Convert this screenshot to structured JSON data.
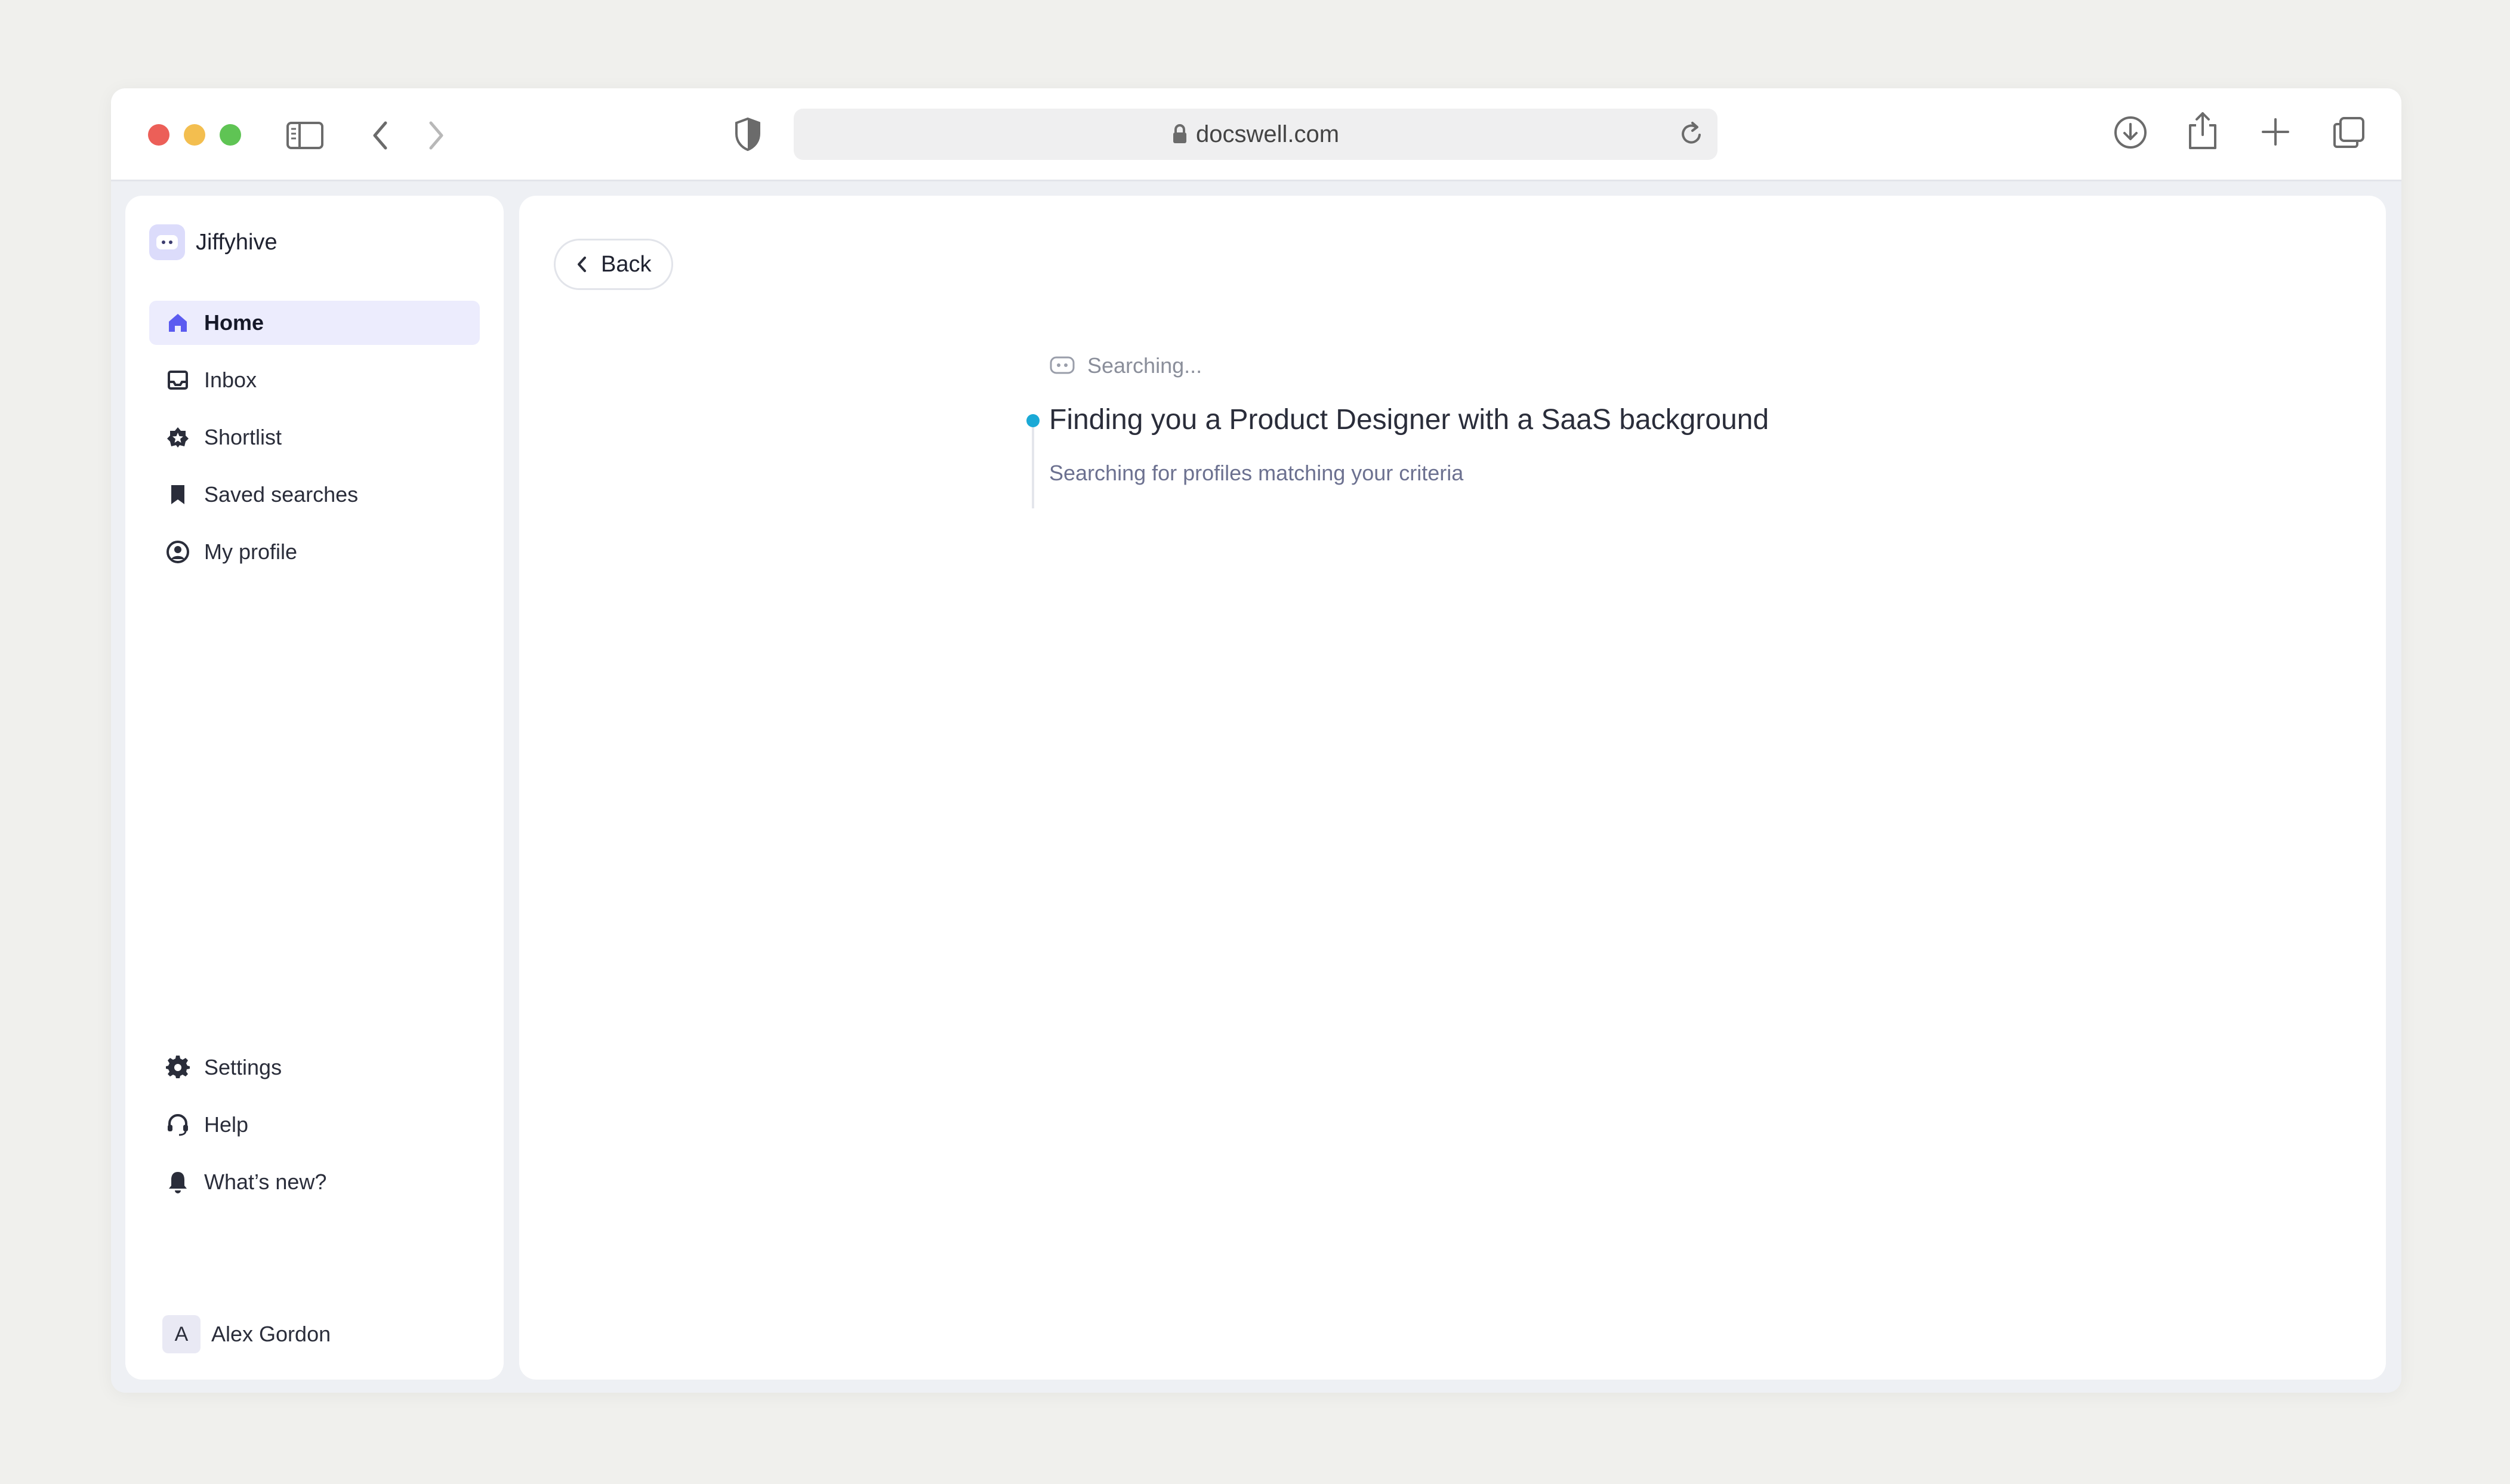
{
  "browser": {
    "url": "docswell.com"
  },
  "app": {
    "brand_name": "Jiffyhive"
  },
  "sidebar": {
    "nav_items": [
      {
        "label": "Home",
        "icon": "home-icon",
        "active": true
      },
      {
        "label": "Inbox",
        "icon": "inbox-icon"
      },
      {
        "label": "Shortlist",
        "icon": "star-badge-icon"
      },
      {
        "label": "Saved searches",
        "icon": "bookmark-icon"
      },
      {
        "label": "My profile",
        "icon": "user-circle-icon"
      }
    ],
    "bottom_items": [
      {
        "label": "Settings",
        "icon": "gear-icon"
      },
      {
        "label": "Help",
        "icon": "headset-icon"
      },
      {
        "label": "What’s new?",
        "icon": "bell-icon"
      }
    ],
    "user": {
      "initial": "A",
      "name": "Alex Gordon"
    }
  },
  "main": {
    "back_label": "Back",
    "status": "Searching...",
    "headline": "Finding you a Product Designer with a SaaS background",
    "subline": "Searching for profiles matching your criteria"
  },
  "colors": {
    "accent": "#5b5bf0",
    "active_bg": "#ececfd",
    "timeline_dot": "#1aa9d6"
  }
}
